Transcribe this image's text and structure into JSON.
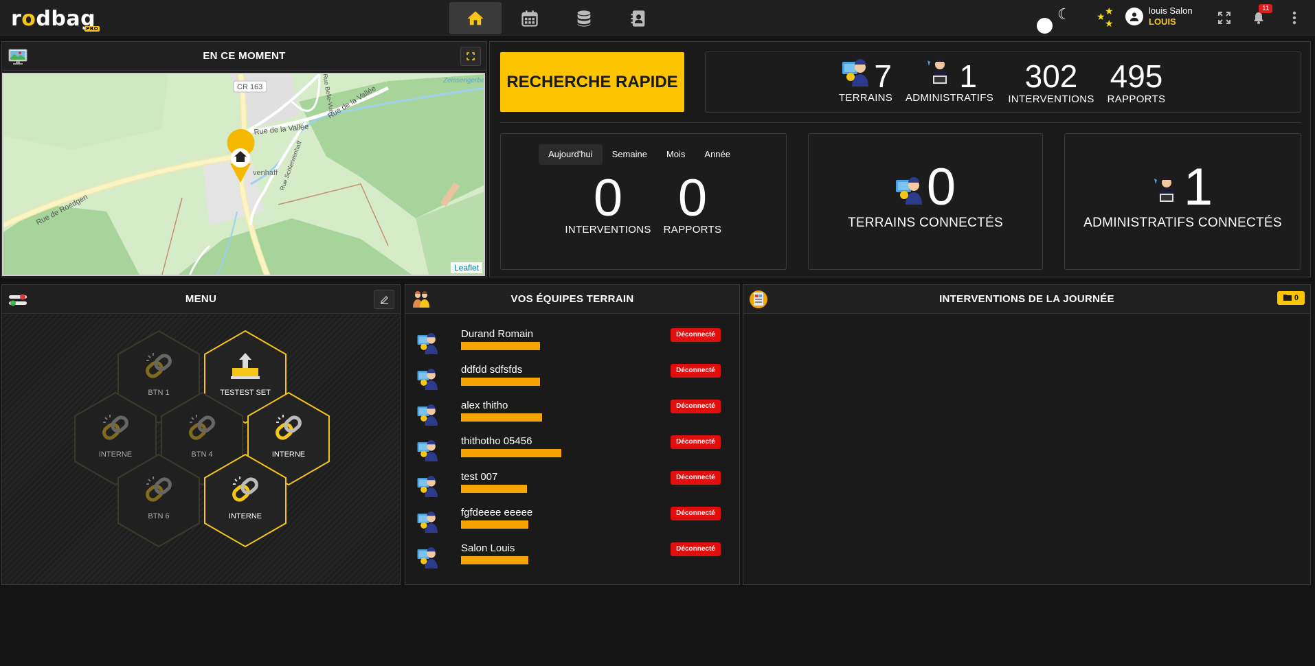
{
  "app": {
    "logo_left": "r",
    "logo_o": "o",
    "logo_right": "dbag",
    "logo_pro": "PRO"
  },
  "nav": {
    "items": [
      {
        "icon": "home-icon",
        "active": true
      },
      {
        "icon": "calendar-icon",
        "active": false
      },
      {
        "icon": "database-icon",
        "active": false
      },
      {
        "icon": "contacts-icon",
        "active": false
      }
    ]
  },
  "user": {
    "name": "louis Salon",
    "sub": "LOUIS",
    "notifications": "11"
  },
  "map_panel": {
    "title": "EN CE MOMENT",
    "labels": {
      "cr": "CR 163",
      "vallee": "Rue de la Vallée",
      "vallee2": "Rue de la Vallée",
      "roedgen": "Rue de Roedgen",
      "belle": "Rue Belle-Vue",
      "village": "venhaff",
      "zeiss": "Zeissengerbaach",
      "schleid": "Rue Schlerwenhaff"
    },
    "attribution": "Leaflet"
  },
  "quick_search": "RECHERCHE RAPIDE",
  "totals": [
    {
      "value": "7",
      "label": "TERRAINS"
    },
    {
      "value": "1",
      "label": "ADMINISTRATIFS"
    },
    {
      "value": "302",
      "label": "INTERVENTIONS"
    },
    {
      "value": "495",
      "label": "RAPPORTS"
    }
  ],
  "period": {
    "tabs": [
      "Aujourd'hui",
      "Semaine",
      "Mois",
      "Année"
    ],
    "active_tab": 0,
    "interventions": {
      "value": "0",
      "label": "INTERVENTIONS"
    },
    "rapports": {
      "value": "0",
      "label": "RAPPORTS"
    }
  },
  "connected": {
    "terrains": {
      "value": "0",
      "label": "TERRAINS CONNECTÉS"
    },
    "admins": {
      "value": "1",
      "label": "ADMINISTRATIFS CONNECTÉS"
    }
  },
  "menu": {
    "title": "MENU",
    "buttons": [
      {
        "label": "BTN 1",
        "on": false
      },
      {
        "label": "TESTEST SET",
        "on": true
      },
      {
        "label": "INTERNE",
        "on": false
      },
      {
        "label": "BTN 4",
        "on": false
      },
      {
        "label": "INTERNE",
        "on": true
      },
      {
        "label": "BTN 6",
        "on": false
      },
      {
        "label": "INTERNE",
        "on": true
      }
    ]
  },
  "teams": {
    "title": "VOS ÉQUIPES TERRAIN",
    "members": [
      {
        "name": "Durand Romain",
        "status": "Déconnecté",
        "bar": 0.48
      },
      {
        "name": "ddfdd sdfsfds",
        "status": "Déconnecté",
        "bar": 0.48
      },
      {
        "name": "alex thitho",
        "status": "Déconnecté",
        "bar": 0.49
      },
      {
        "name": "thithotho 05456",
        "status": "Déconnecté",
        "bar": 0.61
      },
      {
        "name": "test 007",
        "status": "Déconnecté",
        "bar": 0.4
      },
      {
        "name": "fgfdeeee eeeee",
        "status": "Déconnecté",
        "bar": 0.41
      },
      {
        "name": "Salon Louis",
        "status": "Déconnecté",
        "bar": 0.41
      }
    ]
  },
  "interventions_day": {
    "title": "INTERVENTIONS DE LA JOURNÉE",
    "count": "0"
  }
}
